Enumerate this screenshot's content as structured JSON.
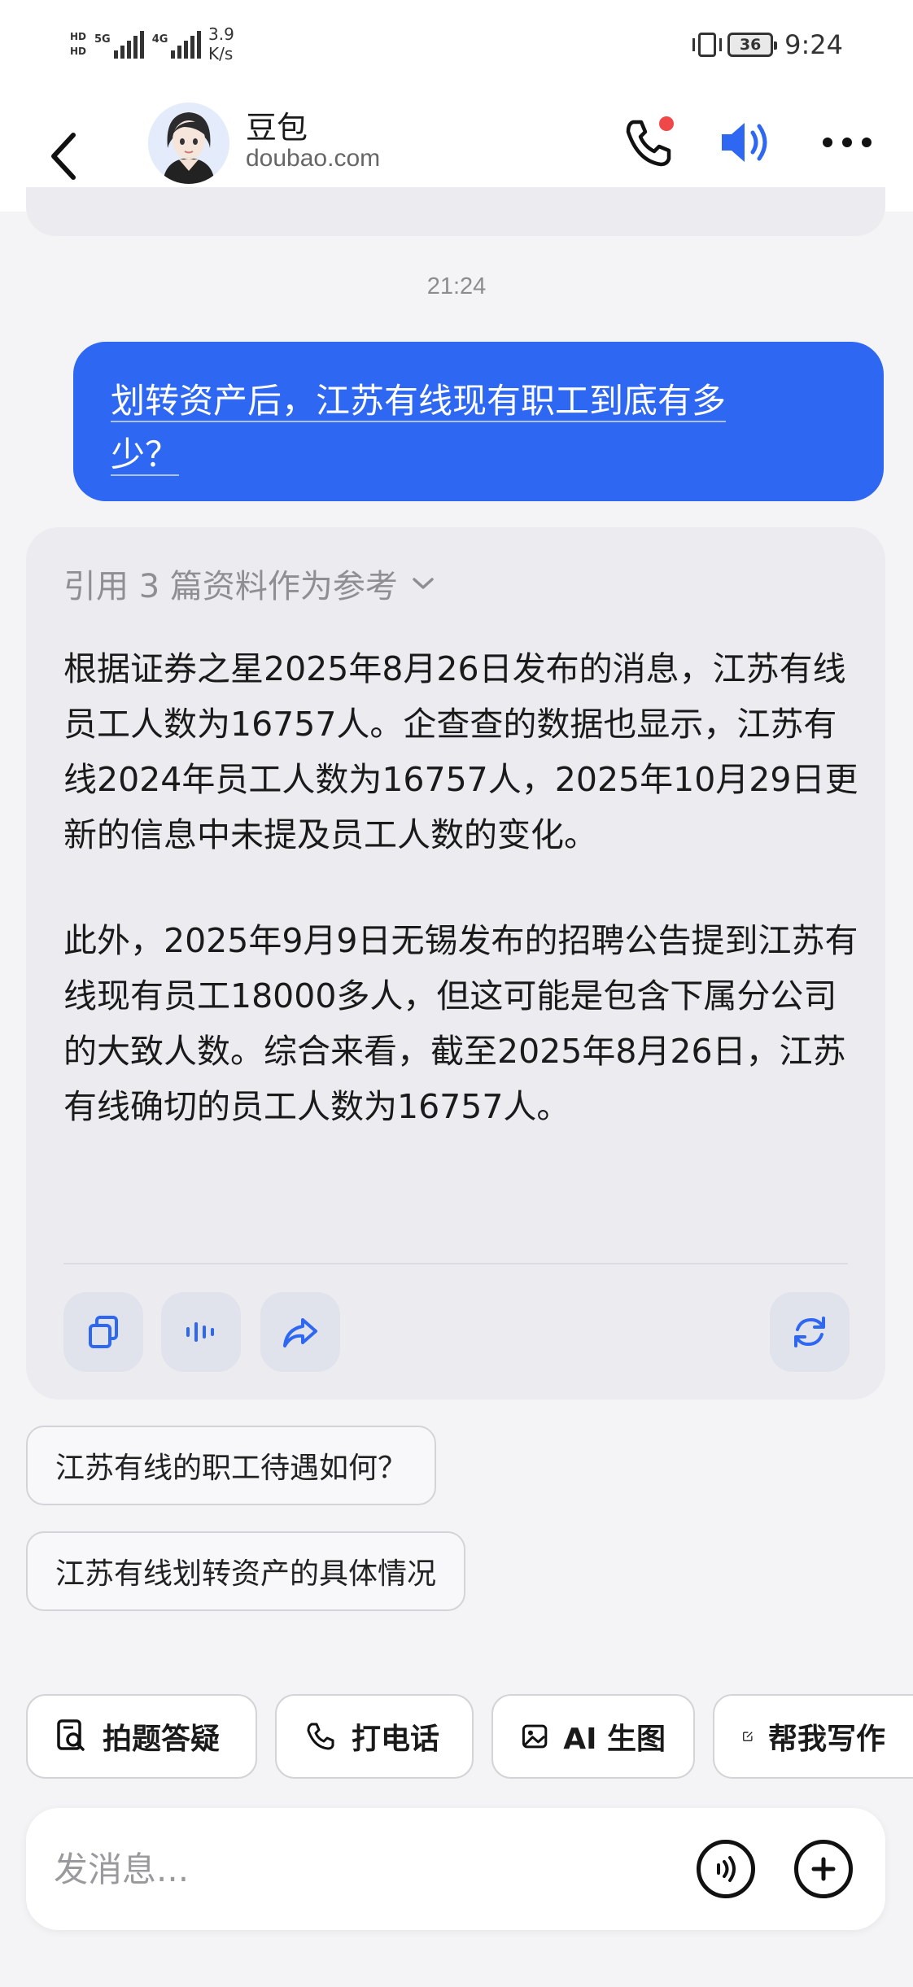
{
  "status_bar": {
    "net_5g": "5G",
    "net_4g": "4G",
    "hd1": "HD",
    "hd2": "HD",
    "speed_value": "3.9",
    "speed_unit": "K/s",
    "battery": "36",
    "time": "9:24"
  },
  "header": {
    "name": "豆包",
    "domain": "doubao.com",
    "call_badge_color": "#f04848",
    "accent": "#2e67f2"
  },
  "chat": {
    "timestamp": "21:24",
    "user_message_line1": "划转资产后，江苏有线现有职工到底有多",
    "user_message_line2": "少？",
    "refs_label": "引用 3 篇资料作为参考",
    "answer_p1": "根据证券之星2025年8月26日发布的消息，江苏有线员工人数为16757人。企查查的数据也显示，江苏有线2024年员工人数为16757人，2025年10月29日更新的信息中未提及员工人数的变化。",
    "answer_p2": "此外，2025年9月9日无锡发布的招聘公告提到江苏有线现有员工18000多人，但这可能是包含下属分公司的大致人数。综合来看，截至2025年8月26日，江苏有线确切的员工人数为16757人。"
  },
  "suggestions": [
    "江苏有线的职工待遇如何？",
    "江苏有线划转资产的具体情况"
  ],
  "quick_actions": [
    {
      "label": "拍题答疑",
      "icon": "search-doc-icon"
    },
    {
      "label": "打电话",
      "icon": "phone-icon"
    },
    {
      "label": "AI 生图",
      "icon": "image-icon"
    },
    {
      "label": "帮我写作",
      "icon": "edit-icon"
    }
  ],
  "composer": {
    "placeholder": "发消息..."
  }
}
